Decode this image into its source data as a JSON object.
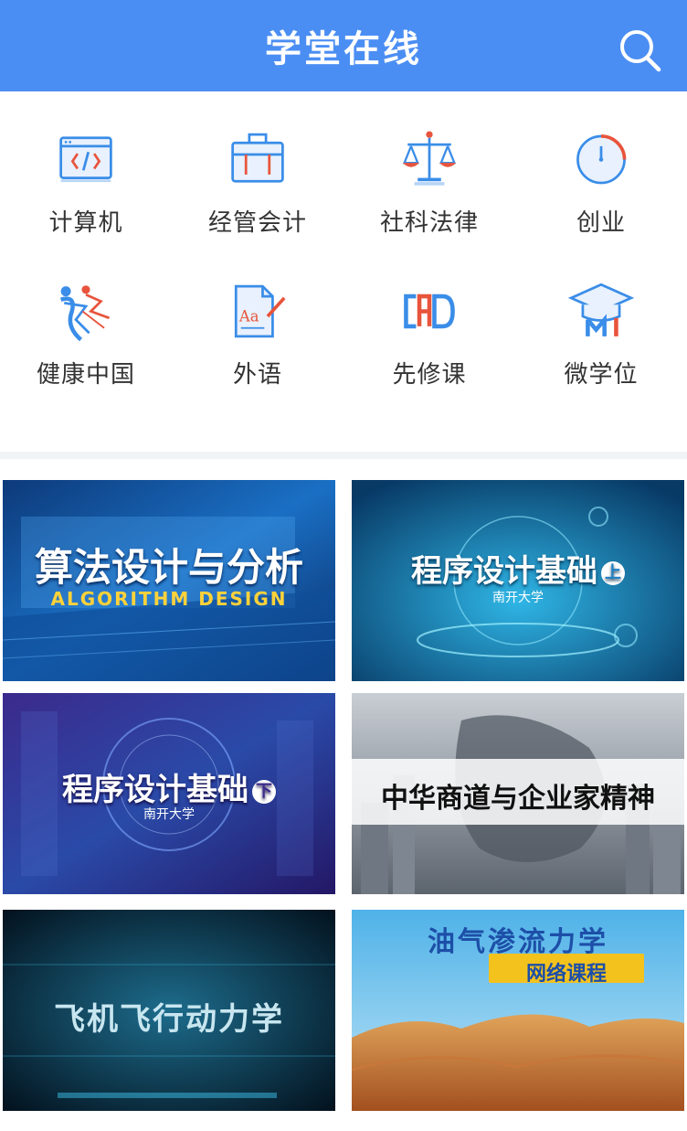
{
  "header": {
    "title": "学堂在线",
    "search_icon": "search-icon",
    "bg_color": "#4b8ef3"
  },
  "categories": [
    {
      "label": "计算机",
      "icon": "code-window-icon"
    },
    {
      "label": "经管会计",
      "icon": "briefcase-icon"
    },
    {
      "label": "社科法律",
      "icon": "scales-icon"
    },
    {
      "label": "创业",
      "icon": "clock-icon"
    },
    {
      "label": "健康中国",
      "icon": "runners-icon"
    },
    {
      "label": "外语",
      "icon": "document-aa-icon"
    },
    {
      "label": "先修课",
      "icon": "cap-letters-icon"
    },
    {
      "label": "微学位",
      "icon": "graduation-cap-icon"
    }
  ],
  "courses": [
    {
      "title": "算法设计与分析",
      "subtitle": "ALGORITHM DESIGN"
    },
    {
      "title": "程序设计基础",
      "badge": "上",
      "school": "南开大学"
    },
    {
      "title": "程序设计基础",
      "badge": "下",
      "school": "南开大学"
    },
    {
      "title": "中华商道与企业家精神"
    },
    {
      "title": "飞机飞行动力学"
    },
    {
      "title": "油气渗流力学",
      "subtitle": "网络课程"
    }
  ]
}
